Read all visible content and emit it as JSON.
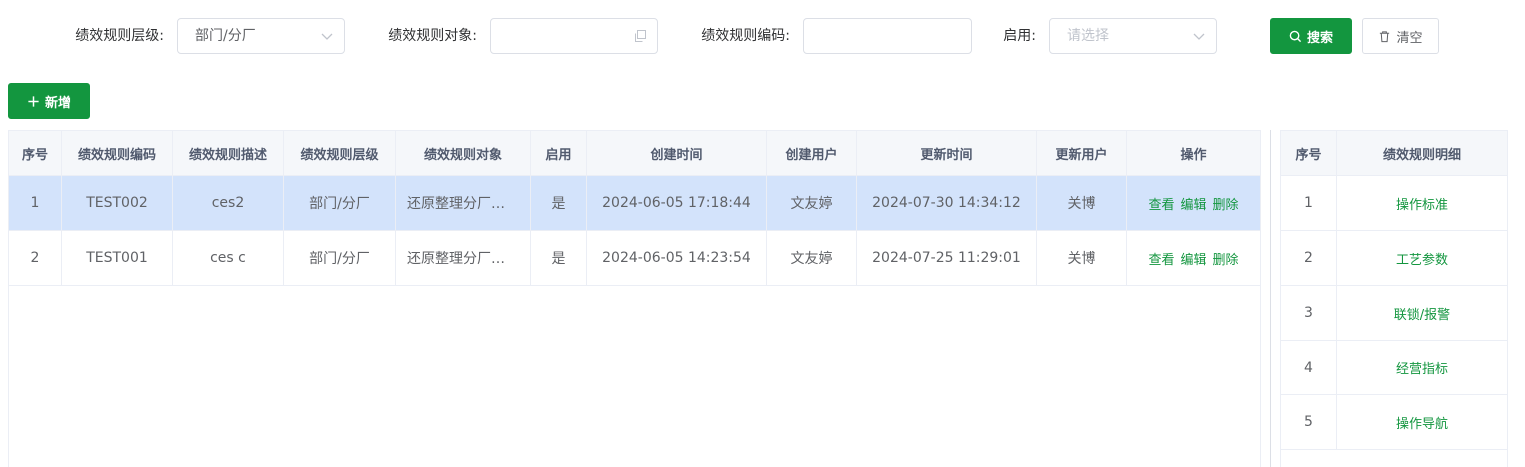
{
  "search": {
    "level_label": "绩效规则层级:",
    "level_value": "部门/分厂",
    "object_label": "绩效规则对象:",
    "object_value": "",
    "code_label": "绩效规则编码:",
    "code_value": "",
    "enabled_label": "启用:",
    "enabled_placeholder": "请选择",
    "search_button": "搜索",
    "clear_button": "清空"
  },
  "toolbar": {
    "add_button": "新增"
  },
  "table": {
    "columns": [
      "序号",
      "绩效规则编码",
      "绩效规则描述",
      "绩效规则层级",
      "绩效规则对象",
      "启用",
      "创建时间",
      "创建用户",
      "更新时间",
      "更新用户",
      "操作"
    ],
    "rows": [
      {
        "index": "1",
        "code": "TEST002",
        "desc": "ces2",
        "level": "部门/分厂",
        "object": "还原整理分厂…",
        "enabled": "是",
        "created": "2024-06-05 17:18:44",
        "creator": "文友婷",
        "updated": "2024-07-30 14:34:12",
        "updater": "关博"
      },
      {
        "index": "2",
        "code": "TEST001",
        "desc": "ces c",
        "level": "部门/分厂",
        "object": "还原整理分厂…",
        "enabled": "是",
        "created": "2024-06-05 14:23:54",
        "creator": "文友婷",
        "updated": "2024-07-25 11:29:01",
        "updater": "关博"
      }
    ],
    "actions": {
      "view": "查看",
      "edit": "编辑",
      "delete": "删除"
    }
  },
  "side_table": {
    "columns": [
      "序号",
      "绩效规则明细"
    ],
    "rows": [
      {
        "index": "1",
        "detail": "操作标准"
      },
      {
        "index": "2",
        "detail": "工艺参数"
      },
      {
        "index": "3",
        "detail": "联锁/报警"
      },
      {
        "index": "4",
        "detail": "经营指标"
      },
      {
        "index": "5",
        "detail": "操作导航"
      }
    ]
  },
  "colors": {
    "primary": "#13963f",
    "selected_row": "#d3e3fb",
    "header_bg": "#f5f7fa",
    "border": "#ebeef5"
  },
  "icons": {
    "select_arrow": "chevron-down-icon",
    "copy": "copy-icon",
    "search": "search-icon",
    "clear": "trash-icon",
    "add": "plus-icon"
  }
}
